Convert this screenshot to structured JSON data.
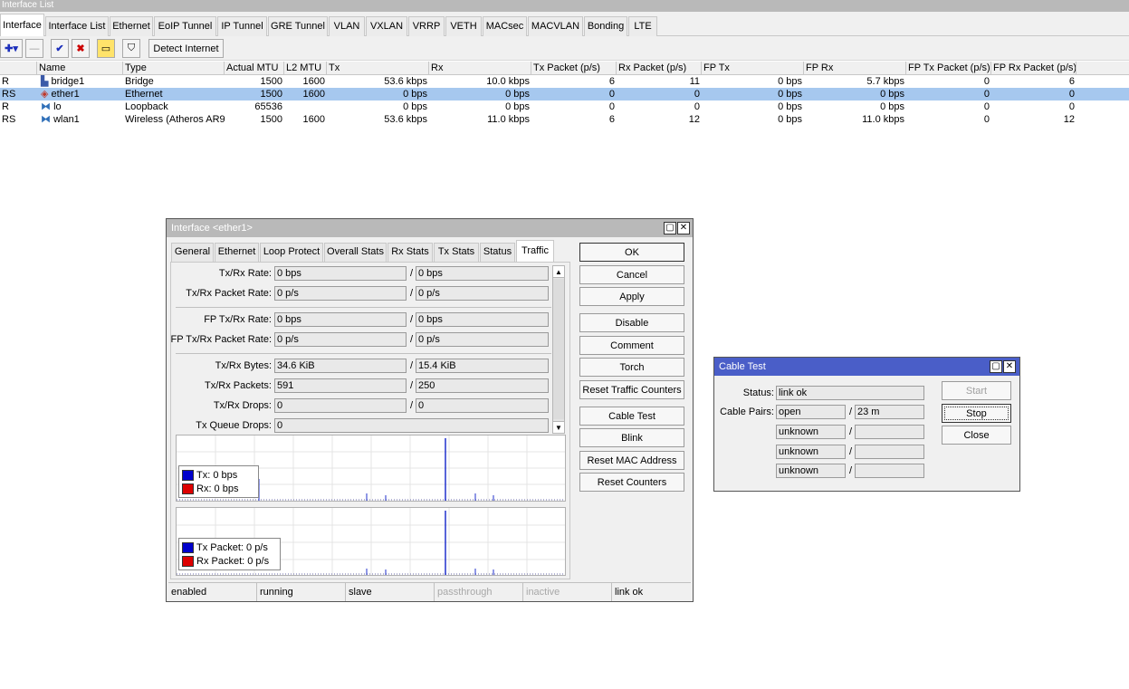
{
  "window": {
    "title": "Interface List"
  },
  "tabs": [
    "Interface",
    "Interface List",
    "Ethernet",
    "EoIP Tunnel",
    "IP Tunnel",
    "GRE Tunnel",
    "VLAN",
    "VXLAN",
    "VRRP",
    "VETH",
    "MACsec",
    "MACVLAN",
    "Bonding",
    "LTE"
  ],
  "toolbar": {
    "add_glyph": "✚▾",
    "remove_glyph": "—",
    "enable_glyph": "✔",
    "disable_glyph": "✖",
    "comment_glyph": "▭",
    "filter_glyph": "⛉",
    "detect_label": "Detect Internet"
  },
  "columns": [
    "",
    "Name",
    "Type",
    "Actual MTU",
    "L2 MTU",
    "Tx",
    "Rx",
    "Tx Packet (p/s)",
    "Rx Packet (p/s)",
    "FP Tx",
    "FP Rx",
    "FP Tx Packet (p/s)",
    "FP Rx Packet (p/s)"
  ],
  "rows": [
    {
      "flag": "R",
      "icon": "bridge-icon",
      "name": "bridge1",
      "type": "Bridge",
      "mtu": "1500",
      "l2mtu": "1600",
      "tx": "53.6 kbps",
      "rx": "10.0 kbps",
      "txp": "6",
      "rxp": "11",
      "fptx": "0 bps",
      "fprx": "5.7 kbps",
      "fptxp": "0",
      "fprxp": "6"
    },
    {
      "flag": "RS",
      "icon": "ethernet-icon",
      "name": "ether1",
      "type": "Ethernet",
      "mtu": "1500",
      "l2mtu": "1600",
      "tx": "0 bps",
      "rx": "0 bps",
      "txp": "0",
      "rxp": "0",
      "fptx": "0 bps",
      "fprx": "0 bps",
      "fptxp": "0",
      "fprxp": "0"
    },
    {
      "flag": "R",
      "icon": "loopback-icon",
      "name": "lo",
      "type": "Loopback",
      "mtu": "65536",
      "l2mtu": "",
      "tx": "0 bps",
      "rx": "0 bps",
      "txp": "0",
      "rxp": "0",
      "fptx": "0 bps",
      "fprx": "0 bps",
      "fptxp": "0",
      "fprxp": "0"
    },
    {
      "flag": "RS",
      "icon": "wireless-icon",
      "name": "wlan1",
      "type": "Wireless (Atheros AR9...",
      "mtu": "1500",
      "l2mtu": "1600",
      "tx": "53.6 kbps",
      "rx": "11.0 kbps",
      "txp": "6",
      "rxp": "12",
      "fptx": "0 bps",
      "fprx": "11.0 kbps",
      "fptxp": "0",
      "fprxp": "12"
    }
  ],
  "iface_dialog": {
    "title": "Interface <ether1>",
    "tabs": [
      "General",
      "Ethernet",
      "Loop Protect",
      "Overall Stats",
      "Rx Stats",
      "Tx Stats",
      "Status",
      "Traffic"
    ],
    "fields": [
      {
        "label": "Tx/Rx Rate:",
        "a": "0 bps",
        "b": "0 bps"
      },
      {
        "label": "Tx/Rx Packet Rate:",
        "a": "0 p/s",
        "b": "0 p/s"
      },
      {
        "label": "FP Tx/Rx Rate:",
        "a": "0 bps",
        "b": "0 bps"
      },
      {
        "label": "FP Tx/Rx Packet Rate:",
        "a": "0 p/s",
        "b": "0 p/s"
      },
      {
        "label": "Tx/Rx Bytes:",
        "a": "34.6 KiB",
        "b": "15.4 KiB"
      },
      {
        "label": "Tx/Rx Packets:",
        "a": "591",
        "b": "250"
      },
      {
        "label": "Tx/Rx Drops:",
        "a": "0",
        "b": "0"
      },
      {
        "label": "Tx Queue Drops:",
        "a": "0"
      }
    ],
    "separator": "/",
    "buttons": [
      "OK",
      "Cancel",
      "Apply",
      "Disable",
      "Comment",
      "Torch",
      "Reset Traffic Counters",
      "Cable Test",
      "Blink",
      "Reset MAC Address",
      "Reset Counters"
    ],
    "graph1": {
      "tx": "Tx:  0 bps",
      "rx": "Rx:  0 bps"
    },
    "graph2": {
      "tx": "Tx Packet:  0 p/s",
      "rx": "Rx Packet:  0 p/s"
    },
    "status": [
      "enabled",
      "running",
      "slave",
      "passthrough",
      "inactive",
      "link ok"
    ],
    "colors": {
      "tx": "#0000cc",
      "rx": "#dd0000"
    }
  },
  "cable_dialog": {
    "title": "Cable Test",
    "status_label": "Status:",
    "status_value": "link ok",
    "pairs_label": "Cable Pairs:",
    "pairs": [
      {
        "state": "open",
        "length": "23 m"
      },
      {
        "state": "unknown",
        "length": ""
      },
      {
        "state": "unknown",
        "length": ""
      },
      {
        "state": "unknown",
        "length": ""
      }
    ],
    "buttons": [
      "Start",
      "Stop",
      "Close"
    ]
  },
  "colors": {
    "accent": "#4a5ec8",
    "selected_row": "#a6c8ef",
    "inactive_title": "#b9b9b9"
  }
}
